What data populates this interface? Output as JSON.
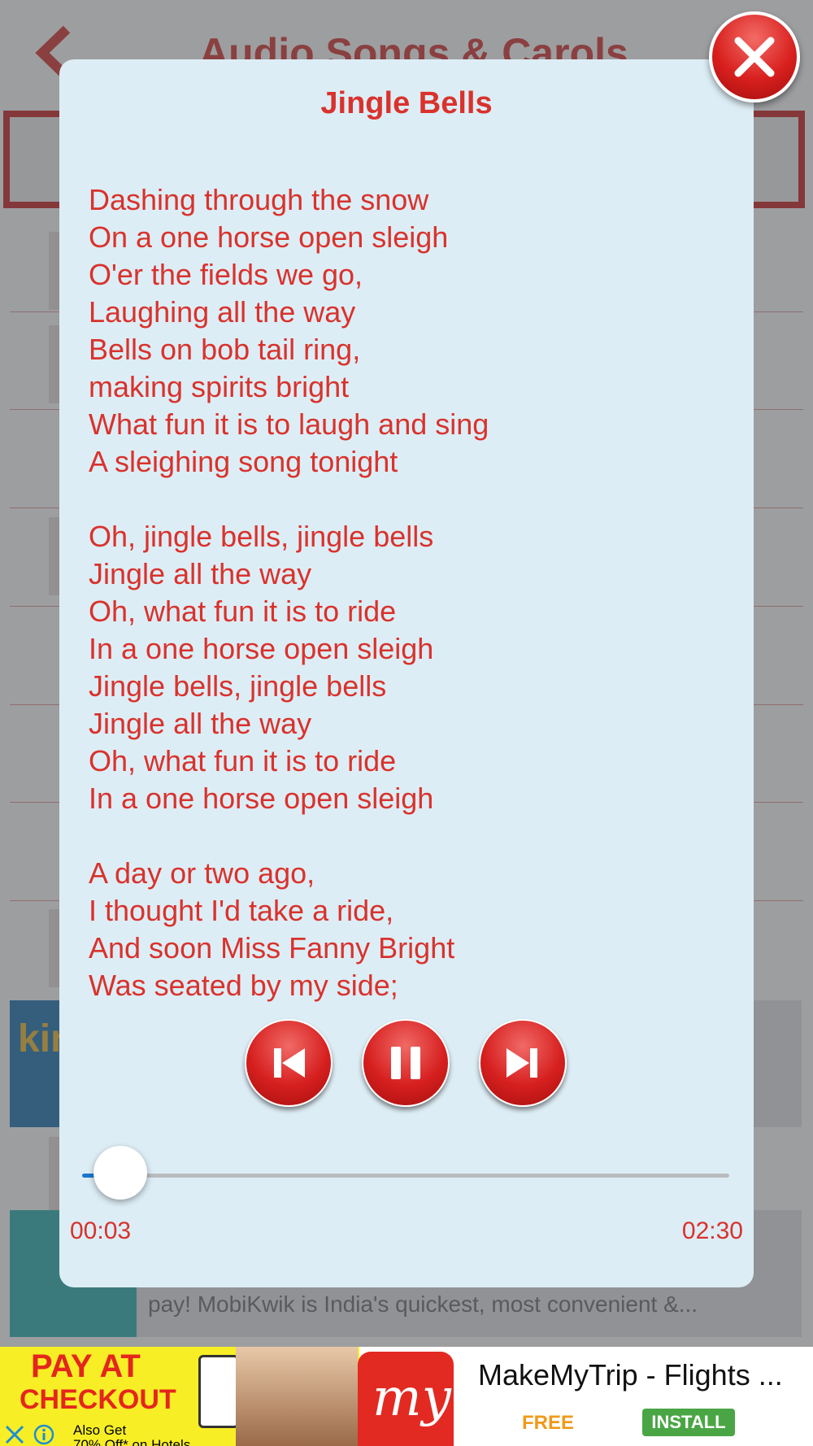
{
  "background": {
    "title": "Audio Songs & Carols",
    "ad_1": {
      "brand": "kin"
    },
    "ad_2": {
      "text": "pay! MobiKwik is India's quickest, most convenient &..."
    }
  },
  "player": {
    "song_title": "Jingle Bells",
    "lyrics": "Dashing through the snow\nOn a one horse open sleigh\nO'er the fields we go,\nLaughing all the way\nBells on bob tail ring,\nmaking spirits bright\nWhat fun it is to laugh and sing\nA sleighing song tonight\n\nOh, jingle bells, jingle bells\nJingle all the way\nOh, what fun it is to ride\nIn a one horse open sleigh\nJingle bells, jingle bells\nJingle all the way\nOh, what fun it is to ride\nIn a one horse open sleigh\n\nA day or two ago,\nI thought I'd take a ride,\nAnd soon Miss Fanny Bright\nWas seated by my side;",
    "current_time": "00:03",
    "total_time": "02:30",
    "progress_fraction": 0.02,
    "controls": [
      "previous-icon",
      "pause-icon",
      "next-icon"
    ],
    "close_icon": "close-icon",
    "accent_color": "#d9322c"
  },
  "bottom_ad": {
    "promo_line1": "PAY AT",
    "promo_line2": "CHECKOUT",
    "promo_small": "Also Get",
    "promo_small2": "70% Off* on Hotels",
    "app_title": "MakeMyTrip - Flights ...",
    "price": "FREE",
    "install_label": "INSTALL",
    "logo_text": "my"
  }
}
